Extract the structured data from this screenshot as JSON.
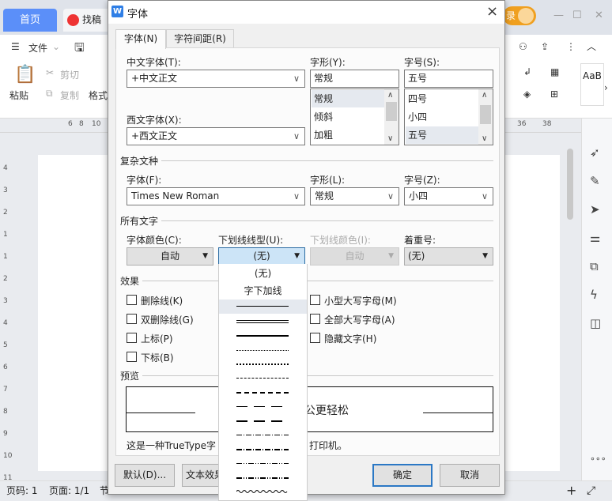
{
  "app": {
    "home_tab": "首页",
    "doc_tab": "找稿",
    "login": "录",
    "file_menu": "文件",
    "toolbar": {
      "paste": "粘贴",
      "cut": "剪切",
      "copy": "复制",
      "format": "格式",
      "styles": "AaB"
    },
    "ruler_ticks": [
      "6",
      "8",
      "10",
      "36",
      "38"
    ],
    "vruler_ticks": [
      "4",
      "3",
      "2",
      "1",
      "1",
      "2",
      "3",
      "4",
      "5",
      "6",
      "7",
      "8",
      "9",
      "10",
      "11"
    ],
    "status": {
      "page_no": "页码: 1",
      "pages": "页面: 1/1",
      "section": "节"
    }
  },
  "dialog": {
    "title": "字体",
    "close": "×",
    "tabs": [
      {
        "label": "字体(N)",
        "active": true
      },
      {
        "label": "字符间距(R)",
        "active": false
      }
    ],
    "cn_font": {
      "label": "中文字体(T):",
      "value": "+中文正文"
    },
    "west_font": {
      "label": "西文字体(X):",
      "value": "+西文正文"
    },
    "style": {
      "label": "字形(Y):",
      "value": "常规",
      "options": [
        "常规",
        "倾斜",
        "加粗"
      ]
    },
    "size": {
      "label": "字号(S):",
      "value": "五号",
      "options": [
        "四号",
        "小四",
        "五号"
      ]
    },
    "complex": {
      "group": "复杂文种",
      "font_label": "字体(F):",
      "font_value": "Times New Roman",
      "style_label": "字形(L):",
      "style_value": "常规",
      "size_label": "字号(Z):",
      "size_value": "小四"
    },
    "all_text": {
      "group": "所有文字",
      "color_label": "字体颜色(C):",
      "color_value": "自动",
      "underline_label": "下划线线型(U):",
      "underline_value": "(无)",
      "ucolor_label": "下划线颜色(I):",
      "ucolor_value": "自动",
      "emph_label": "着重号:",
      "emph_value": "(无)"
    },
    "effects": {
      "group": "效果",
      "left": [
        "删除线(K)",
        "双删除线(G)",
        "上标(P)",
        "下标(B)"
      ],
      "right": [
        "小型大写字母(M)",
        "全部大写字母(A)",
        "隐藏文字(H)"
      ]
    },
    "preview": {
      "group": "预览",
      "sample": "公更轻松",
      "note_a": "这是一种TrueType字",
      "note_b": "打印机。"
    },
    "buttons": {
      "default": "默认(D)...",
      "text_effects": "文本效果",
      "ok": "确定",
      "cancel": "取消"
    },
    "underline_options": [
      "(无)",
      "字下加线"
    ]
  }
}
